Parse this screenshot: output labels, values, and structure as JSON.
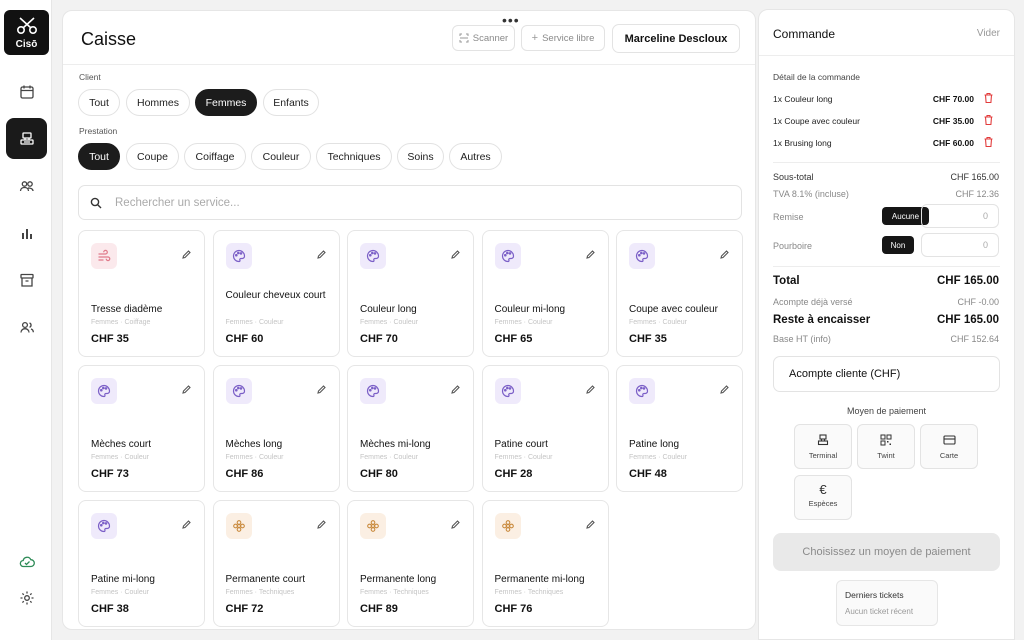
{
  "app": {
    "logo_text": "Cisō"
  },
  "nav": [
    {
      "icon": "calendar-icon"
    },
    {
      "icon": "register-icon",
      "active": true
    },
    {
      "icon": "users-icon"
    },
    {
      "icon": "bar-chart-icon"
    },
    {
      "icon": "archive-icon"
    },
    {
      "icon": "team-icon"
    }
  ],
  "nav_bottom": [
    {
      "icon": "cloud-icon"
    },
    {
      "icon": "gear-icon"
    }
  ],
  "header": {
    "title": "Caisse",
    "scanner_label": "Scanner",
    "service_libre_label": "Service libre",
    "staff_name": "Marceline Descloux"
  },
  "filters": {
    "client_label": "Client",
    "client_options": [
      "Tout",
      "Hommes",
      "Femmes",
      "Enfants"
    ],
    "client_selected": "Femmes",
    "prestation_label": "Prestation",
    "prestation_options": [
      "Tout",
      "Coupe",
      "Coiffage",
      "Couleur",
      "Techniques",
      "Soins",
      "Autres"
    ],
    "prestation_selected": "Tout"
  },
  "search": {
    "placeholder": "Rechercher un service..."
  },
  "services": [
    {
      "name": "Tresse diadème",
      "sub": "Femmes · Coiffage",
      "price": "CHF 35",
      "icon": "wind-icon"
    },
    {
      "name": "Couleur cheveux court",
      "sub": "Femmes · Couleur",
      "price": "CHF 60",
      "icon": "palette-icon"
    },
    {
      "name": "Couleur long",
      "sub": "Femmes · Couleur",
      "price": "CHF 70",
      "icon": "palette-icon"
    },
    {
      "name": "Couleur mi-long",
      "sub": "Femmes · Couleur",
      "price": "CHF 65",
      "icon": "palette-icon"
    },
    {
      "name": "Coupe avec couleur",
      "sub": "Femmes · Couleur",
      "price": "CHF 35",
      "icon": "palette-icon"
    },
    {
      "name": "Mèches court",
      "sub": "Femmes · Couleur",
      "price": "CHF 73",
      "icon": "palette-icon"
    },
    {
      "name": "Mèches long",
      "sub": "Femmes · Couleur",
      "price": "CHF 86",
      "icon": "palette-icon"
    },
    {
      "name": "Mèches mi-long",
      "sub": "Femmes · Couleur",
      "price": "CHF 80",
      "icon": "palette-icon"
    },
    {
      "name": "Patine court",
      "sub": "Femmes · Couleur",
      "price": "CHF 28",
      "icon": "palette-icon"
    },
    {
      "name": "Patine long",
      "sub": "Femmes · Couleur",
      "price": "CHF 48",
      "icon": "palette-icon"
    },
    {
      "name": "Patine mi-long",
      "sub": "Femmes · Couleur",
      "price": "CHF 38",
      "icon": "palette-icon"
    },
    {
      "name": "Permanente court",
      "sub": "Femmes · Techniques",
      "price": "CHF 72",
      "icon": "flower-icon"
    },
    {
      "name": "Permanente long",
      "sub": "Femmes · Techniques",
      "price": "CHF 89",
      "icon": "flower-icon"
    },
    {
      "name": "Permanente mi-long",
      "sub": "Femmes · Techniques",
      "price": "CHF 76",
      "icon": "flower-icon"
    }
  ],
  "order": {
    "title": "Commande",
    "clear_label": "Vider",
    "detail_label": "Détail de la commande",
    "lines": [
      {
        "label": "1x Couleur long",
        "price": "CHF 70.00"
      },
      {
        "label": "1x Coupe avec couleur",
        "price": "CHF 35.00"
      },
      {
        "label": "1x Brusing long",
        "price": "CHF 60.00"
      }
    ],
    "subtotal_label": "Sous-total",
    "subtotal": "CHF 165.00",
    "tva_label": "TVA 8.1% (incluse)",
    "tva": "CHF 12.36",
    "discount_label": "Remise",
    "discount_pill": "Aucune",
    "discount_value": "0",
    "tip_label": "Pourboire",
    "tip_pill": "Non",
    "tip_value": "0",
    "total_label": "Total",
    "total": "CHF 165.00",
    "deposit_paid_label": "Acompte déjà versé",
    "deposit_paid": "CHF -0.00",
    "remaining_label": "Reste à encaisser",
    "remaining": "CHF 165.00",
    "base_ht_label": "Base HT (info)",
    "base_ht": "CHF 152.64",
    "deposit_button": "Acompte cliente (CHF)",
    "payment_title": "Moyen de paiement",
    "payment_methods": [
      {
        "label": "Terminal",
        "icon": "terminal-icon"
      },
      {
        "label": "Twint",
        "icon": "qr-code-icon"
      },
      {
        "label": "Carte",
        "icon": "card-icon"
      },
      {
        "label": "Espèces",
        "icon": "euro-icon"
      }
    ],
    "pay_button": "Choisissez un moyen de paiement",
    "tickets_title": "Derniers tickets",
    "tickets_empty": "Aucun ticket récent"
  }
}
